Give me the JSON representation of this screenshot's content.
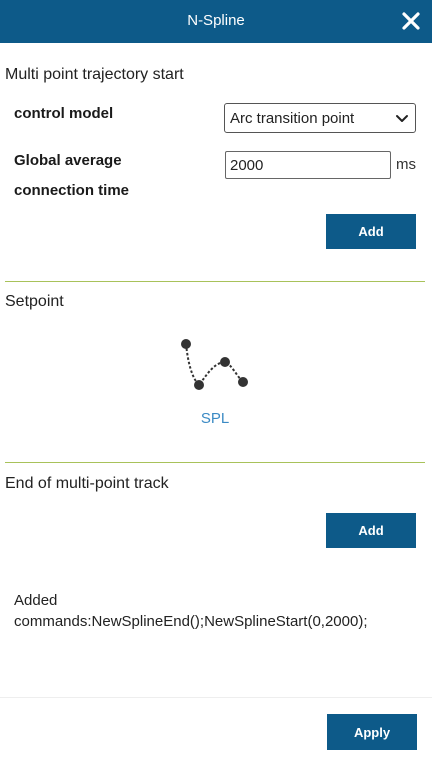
{
  "window": {
    "title": "N-Spline",
    "close_icon": "close-icon"
  },
  "start_section": {
    "title": "Multi point trajectory start",
    "control_model_label": "control model",
    "control_model_value": "Arc transition point",
    "time_label_line1": "Global average",
    "time_label_line2": "connection time",
    "time_value": "2000",
    "time_unit": "ms",
    "add_label": "Add"
  },
  "setpoint_section": {
    "title": "Setpoint",
    "spl_label": "SPL",
    "spl_icon": "spline-curve-icon"
  },
  "end_section": {
    "title": "End of multi-point track",
    "add_label": "Add"
  },
  "status": {
    "line1": "Added",
    "line2": "commands:NewSplineEnd();NewSplineStart(0,2000);"
  },
  "footer": {
    "apply_label": "Apply"
  },
  "colors": {
    "header": "#0d5a89",
    "button": "#0d5a89",
    "divider": "#a8c25a",
    "link": "#3b8ac4"
  }
}
